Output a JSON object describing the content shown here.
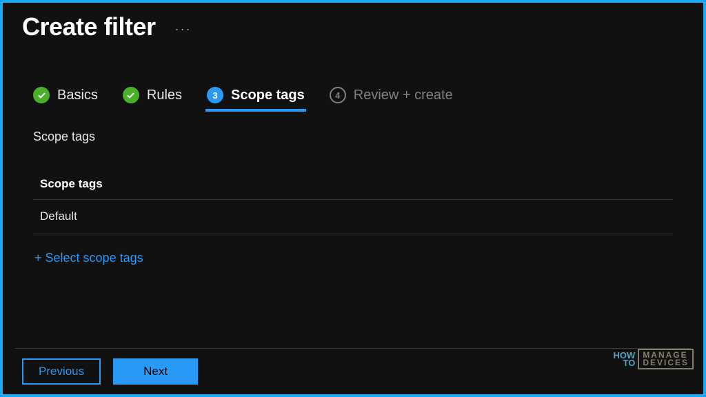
{
  "header": {
    "title": "Create filter"
  },
  "steps": [
    {
      "label": "Basics",
      "state": "complete"
    },
    {
      "label": "Rules",
      "state": "complete"
    },
    {
      "label": "Scope tags",
      "state": "active",
      "number": "3"
    },
    {
      "label": "Review + create",
      "state": "upcoming",
      "number": "4"
    }
  ],
  "section": {
    "label": "Scope tags",
    "table_header": "Scope tags",
    "rows": [
      "Default"
    ],
    "select_link": "+ Select scope tags"
  },
  "footer": {
    "previous": "Previous",
    "next": "Next"
  },
  "watermark": {
    "how": "HOW",
    "to": "TO",
    "manage": "MANAGE",
    "devices": "DEVICES"
  }
}
